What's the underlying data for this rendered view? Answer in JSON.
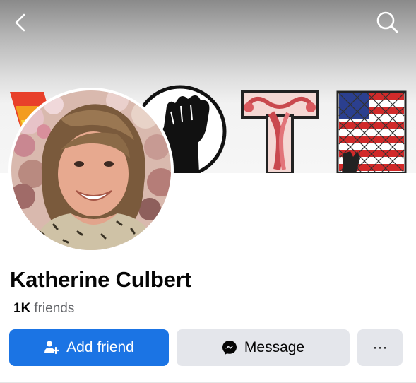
{
  "profile": {
    "name": "Katherine Culbert",
    "friends_count": "1K",
    "friends_label": "friends"
  },
  "cover": {
    "text": "VOTE"
  },
  "actions": {
    "add_friend_label": "Add friend",
    "message_label": "Message",
    "more_label": "···"
  },
  "nav": {
    "back_icon": "chevron-left-icon",
    "search_icon": "search-icon"
  },
  "colors": {
    "primary_button": "#1b74e4",
    "secondary_button": "#e4e6eb",
    "name_text": "#050505",
    "muted_text": "#65676b"
  }
}
